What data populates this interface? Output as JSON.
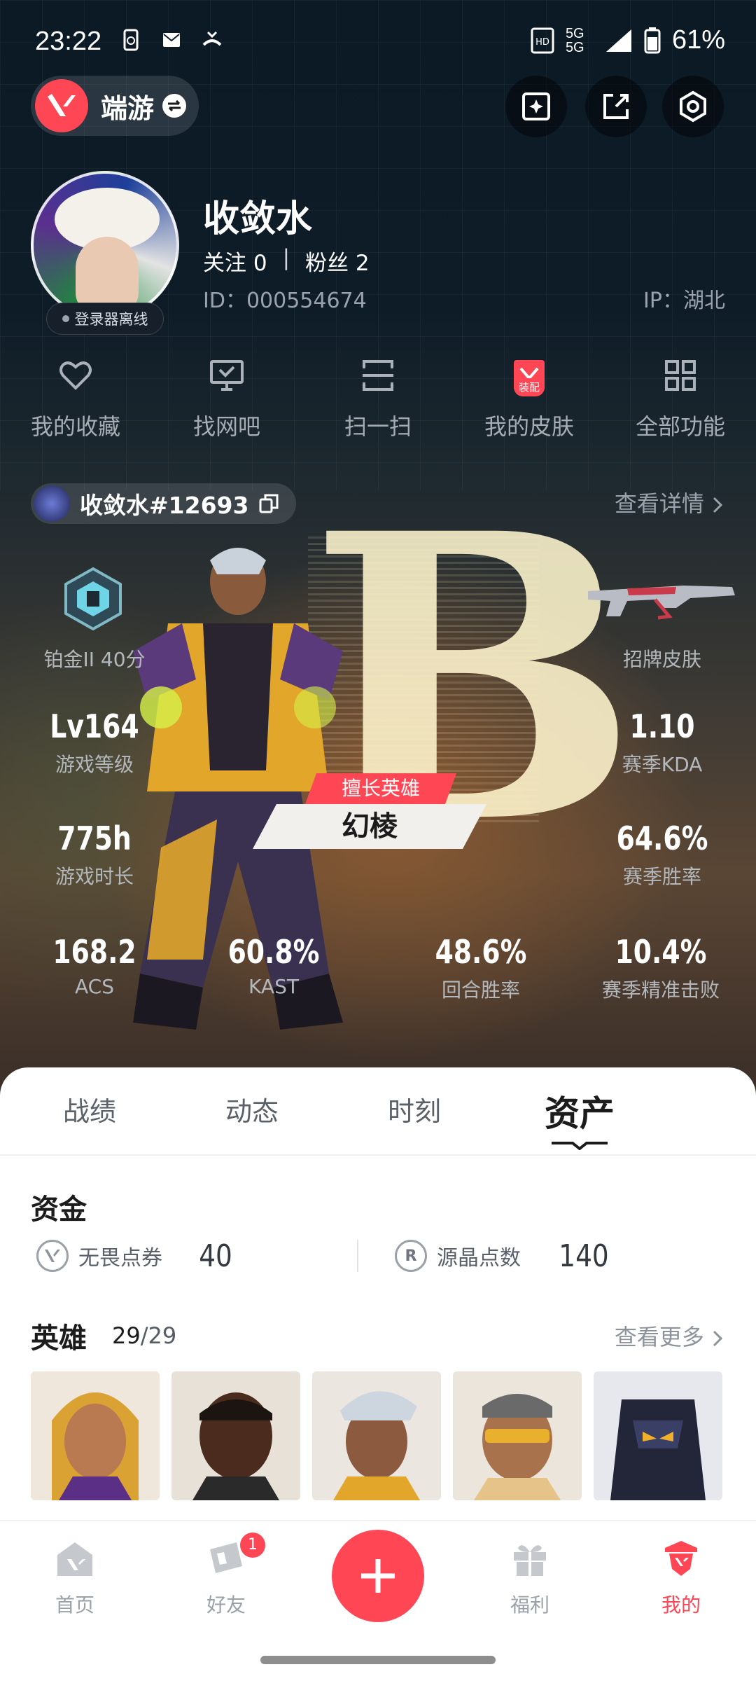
{
  "status_bar": {
    "time": "23:22",
    "network": "5G",
    "battery": "61%"
  },
  "game": {
    "name": "端游"
  },
  "profile": {
    "username": "收敛水",
    "follow_label": "关注 0",
    "separator": "|",
    "fans_label": "粉丝 2",
    "id_label": "ID：000554674",
    "ip_label": "IP：湖北",
    "status": "登录器离线"
  },
  "quick_menu": [
    {
      "label": "我的收藏",
      "icon": "heart-icon"
    },
    {
      "label": "找网吧",
      "icon": "monitor-icon"
    },
    {
      "label": "扫一扫",
      "icon": "scan-icon"
    },
    {
      "label": "我的皮肤",
      "icon": "skin-icon",
      "badge": "装配"
    },
    {
      "label": "全部功能",
      "icon": "grid-icon"
    }
  ],
  "riot": {
    "name": "收敛水#12693",
    "detail_link": "查看详情"
  },
  "rank": {
    "grade": "B",
    "label": "铂金II 40分",
    "skin_label": "招牌皮肤"
  },
  "stats": {
    "level": {
      "value": "Lv164",
      "label": "游戏等级"
    },
    "kda": {
      "value": "1.10",
      "label": "赛季KDA"
    },
    "hours": {
      "value": "775h",
      "label": "游戏时长"
    },
    "winrate": {
      "value": "64.6%",
      "label": "赛季胜率"
    },
    "acs": {
      "value": "168.2",
      "label": "ACS"
    },
    "kast": {
      "value": "60.8%",
      "label": "KAST"
    },
    "round_winrate": {
      "value": "48.6%",
      "label": "回合胜率"
    },
    "headshot": {
      "value": "10.4%",
      "label": "赛季精准击败"
    }
  },
  "favorite_hero": {
    "tag": "擅长英雄",
    "name": "幻棱"
  },
  "tabs": [
    "战绩",
    "动态",
    "时刻",
    "资产"
  ],
  "assets": {
    "funds_title": "资金",
    "vp": {
      "label": "无畏点券",
      "value": "40"
    },
    "rp": {
      "label": "源晶点数",
      "value": "140"
    },
    "heroes_title": "英雄",
    "heroes_owned": "29",
    "heroes_sep": "/",
    "heroes_total": "29",
    "more_link": "查看更多"
  },
  "bottom_nav": [
    {
      "label": "首页",
      "icon": "home-icon"
    },
    {
      "label": "好友",
      "icon": "friends-icon",
      "badge": "1"
    },
    {
      "label": "福利",
      "icon": "gift-icon"
    },
    {
      "label": "我的",
      "icon": "profile-icon"
    }
  ],
  "colors": {
    "accent": "#ff4655"
  }
}
